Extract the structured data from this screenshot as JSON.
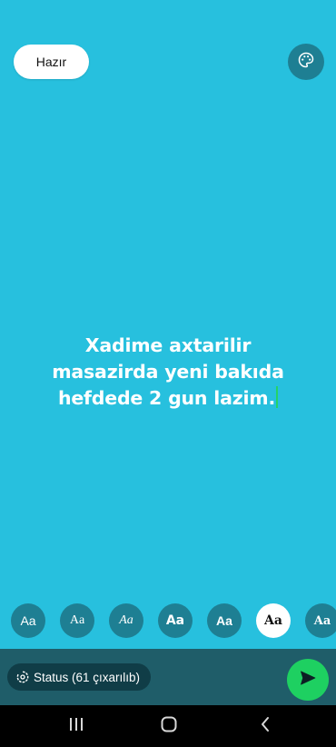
{
  "editor": {
    "done_label": "Hazır",
    "text_lines": [
      "Xadime axtarilir",
      "masazirda yeni bakıda",
      "hefdede 2 gun lazim."
    ],
    "background_color": "#27c0de",
    "palette_icon": "palette-icon"
  },
  "font_options": [
    {
      "label": "Aa",
      "style": "sans",
      "selected": false
    },
    {
      "label": "Aa",
      "style": "serif",
      "selected": false
    },
    {
      "label": "Aa",
      "style": "italic-script",
      "selected": false
    },
    {
      "label": "Aa",
      "style": "bold-rounded",
      "selected": false
    },
    {
      "label": "Aa",
      "style": "bold-condensed",
      "selected": false
    },
    {
      "label": "Aa",
      "style": "bold-serif",
      "selected": true
    },
    {
      "label": "Aa",
      "style": "slab",
      "selected": false
    }
  ],
  "bottom_bar": {
    "status_label": "Status (61 çıxarılıb)",
    "status_icon": "status-ring-icon",
    "send_icon": "send-icon",
    "send_color": "#1ed061"
  },
  "nav": {
    "recents_icon": "recents-icon",
    "home_icon": "home-icon",
    "back_icon": "back-icon"
  }
}
